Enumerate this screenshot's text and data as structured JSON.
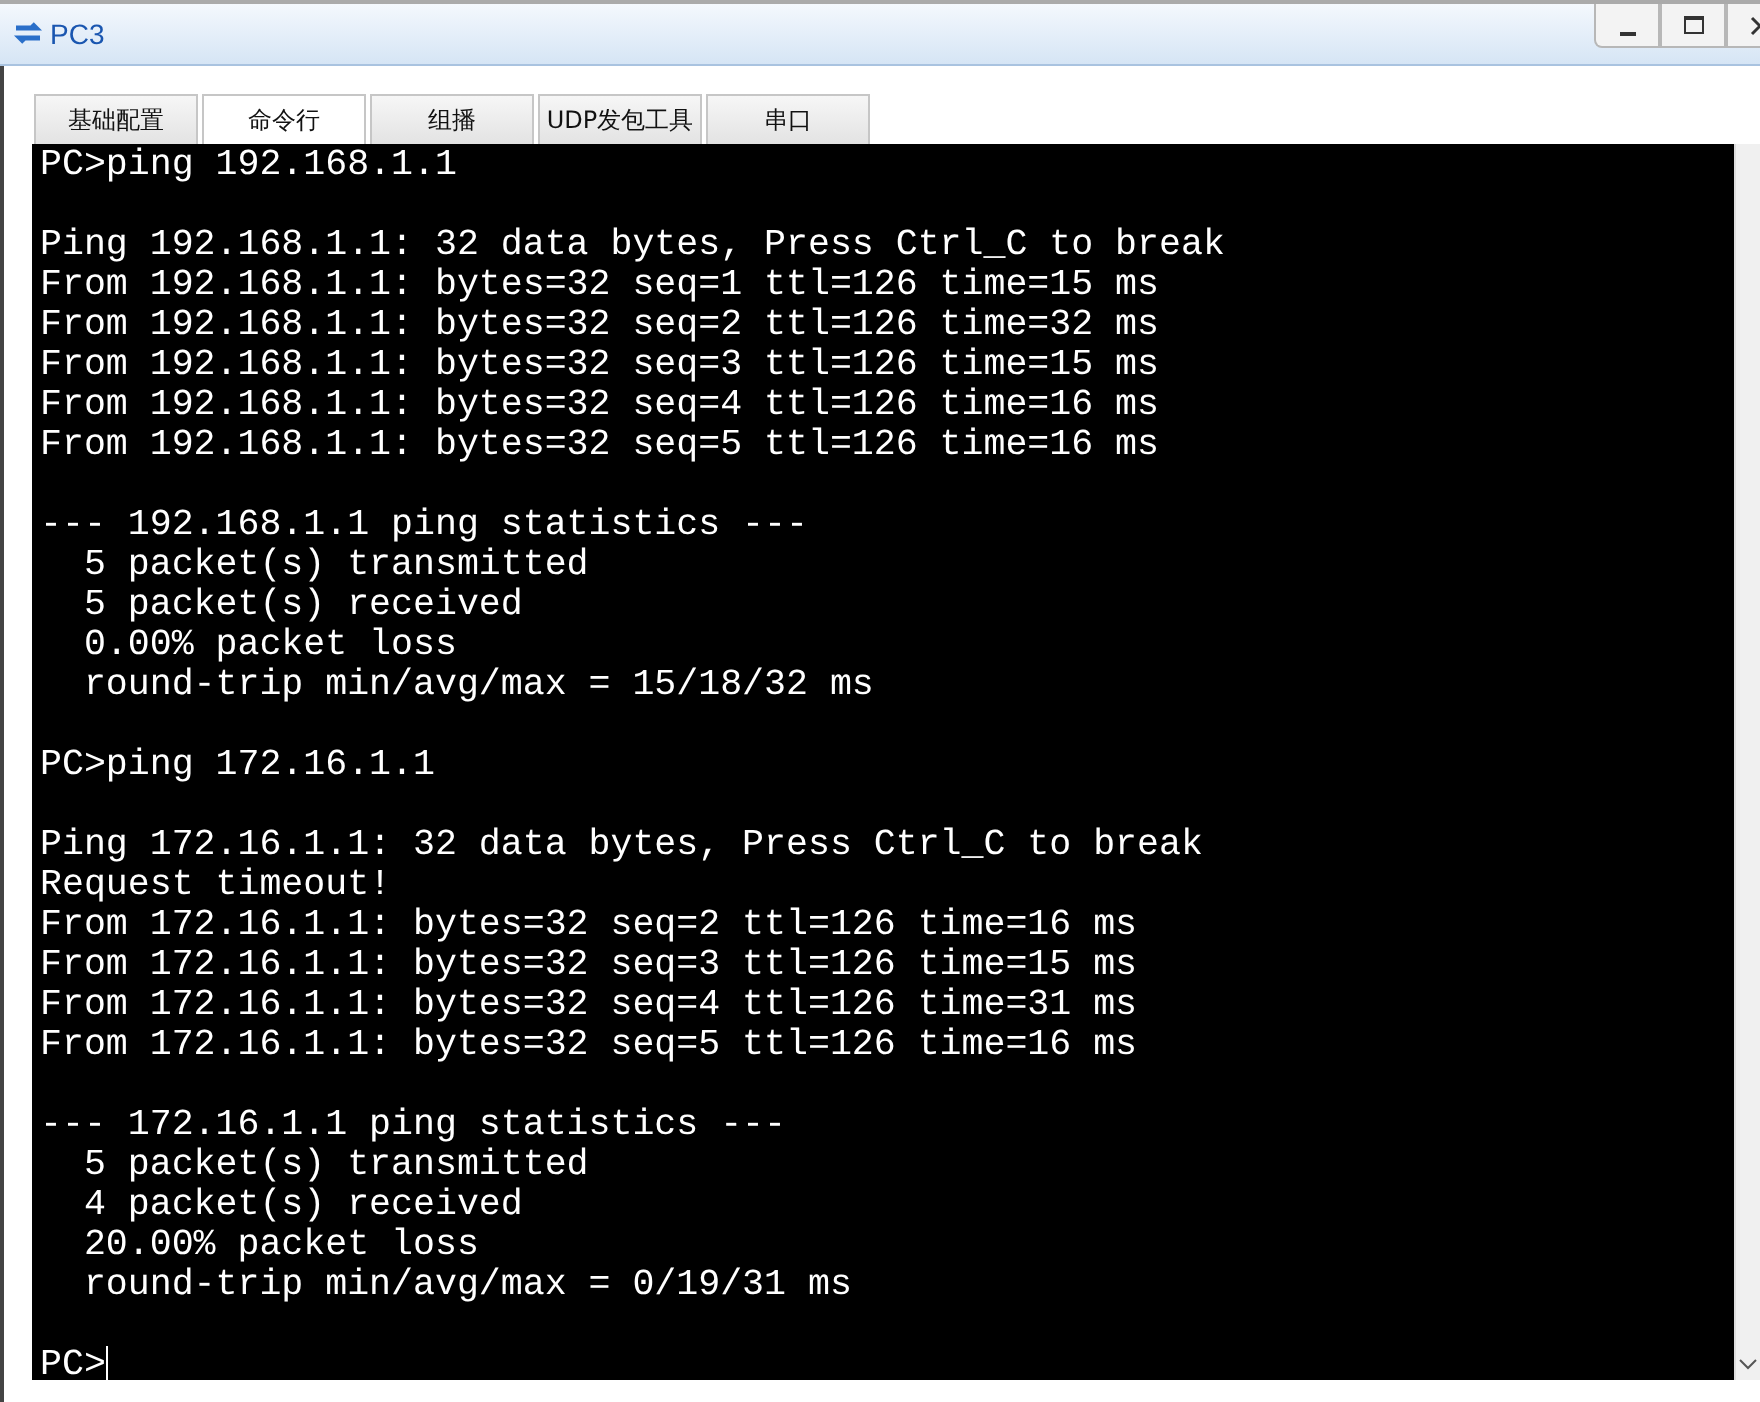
{
  "window": {
    "title": "PC3"
  },
  "tabs": [
    {
      "label": "基础配置",
      "selected": false
    },
    {
      "label": "命令行",
      "selected": true
    },
    {
      "label": "组播",
      "selected": false
    },
    {
      "label": "UDP发包工具",
      "selected": false
    },
    {
      "label": "串口",
      "selected": false
    }
  ],
  "terminal": {
    "blocks": [
      [
        "PC>ping 192.168.1.1"
      ],
      [
        "Ping 192.168.1.1: 32 data bytes, Press Ctrl_C to break",
        "From 192.168.1.1: bytes=32 seq=1 ttl=126 time=15 ms",
        "From 192.168.1.1: bytes=32 seq=2 ttl=126 time=32 ms",
        "From 192.168.1.1: bytes=32 seq=3 ttl=126 time=15 ms",
        "From 192.168.1.1: bytes=32 seq=4 ttl=126 time=16 ms",
        "From 192.168.1.1: bytes=32 seq=5 ttl=126 time=16 ms"
      ],
      [
        "--- 192.168.1.1 ping statistics ---",
        "  5 packet(s) transmitted",
        "  5 packet(s) received",
        "  0.00% packet loss",
        "  round-trip min/avg/max = 15/18/32 ms"
      ],
      [
        "PC>ping 172.16.1.1"
      ],
      [
        "Ping 172.16.1.1: 32 data bytes, Press Ctrl_C to break",
        "Request timeout!",
        "From 172.16.1.1: bytes=32 seq=2 ttl=126 time=16 ms",
        "From 172.16.1.1: bytes=32 seq=3 ttl=126 time=15 ms",
        "From 172.16.1.1: bytes=32 seq=4 ttl=126 time=31 ms",
        "From 172.16.1.1: bytes=32 seq=5 ttl=126 time=16 ms"
      ],
      [
        "--- 172.16.1.1 ping statistics ---",
        "  5 packet(s) transmitted",
        "  4 packet(s) received",
        "  20.00% packet loss",
        "  round-trip min/avg/max = 0/19/31 ms"
      ],
      [
        "PC>"
      ]
    ]
  }
}
